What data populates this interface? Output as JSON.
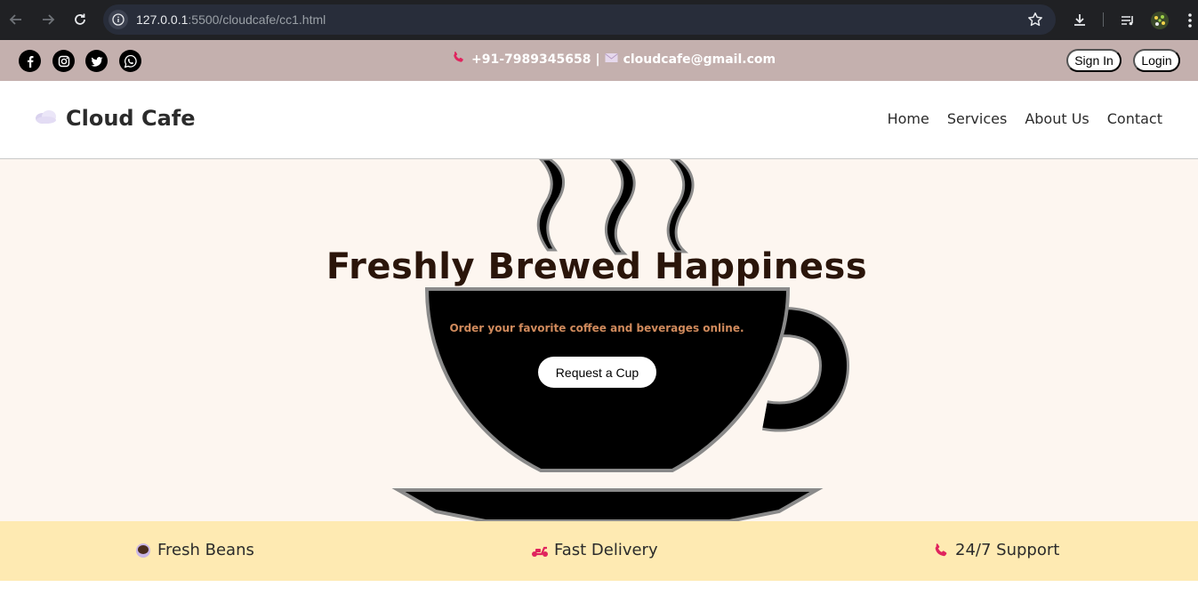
{
  "browser": {
    "url_host": "127.0.0.1",
    "url_rest": ":5500/cloudcafe/cc1.html"
  },
  "topbar": {
    "phone": "+91-7989345658",
    "separator": "|",
    "email": "cloudcafe@gmail.com",
    "signin_label": "Sign In",
    "login_label": "Login",
    "social_icons": [
      "facebook-icon",
      "instagram-icon",
      "twitter-icon",
      "whatsapp-icon"
    ],
    "background": "#c4b0ae"
  },
  "nav": {
    "brand": "Cloud Cafe",
    "links": [
      "Home",
      "Services",
      "About Us",
      "Contact"
    ]
  },
  "hero": {
    "title": "Freshly Brewed Happiness",
    "subtitle": "Order your favorite coffee and beverages online.",
    "cta_label": "Request a Cup",
    "background": "#fdf6f0",
    "title_color": "#2a150a",
    "subtitle_color": "#d08a5c"
  },
  "features": {
    "background": "#feeab2",
    "items": [
      {
        "label": "Fresh Beans",
        "icon": "coffee-bean-icon"
      },
      {
        "label": "Fast Delivery",
        "icon": "scooter-icon"
      },
      {
        "label": "24/7 Support",
        "icon": "phone-icon"
      }
    ]
  }
}
